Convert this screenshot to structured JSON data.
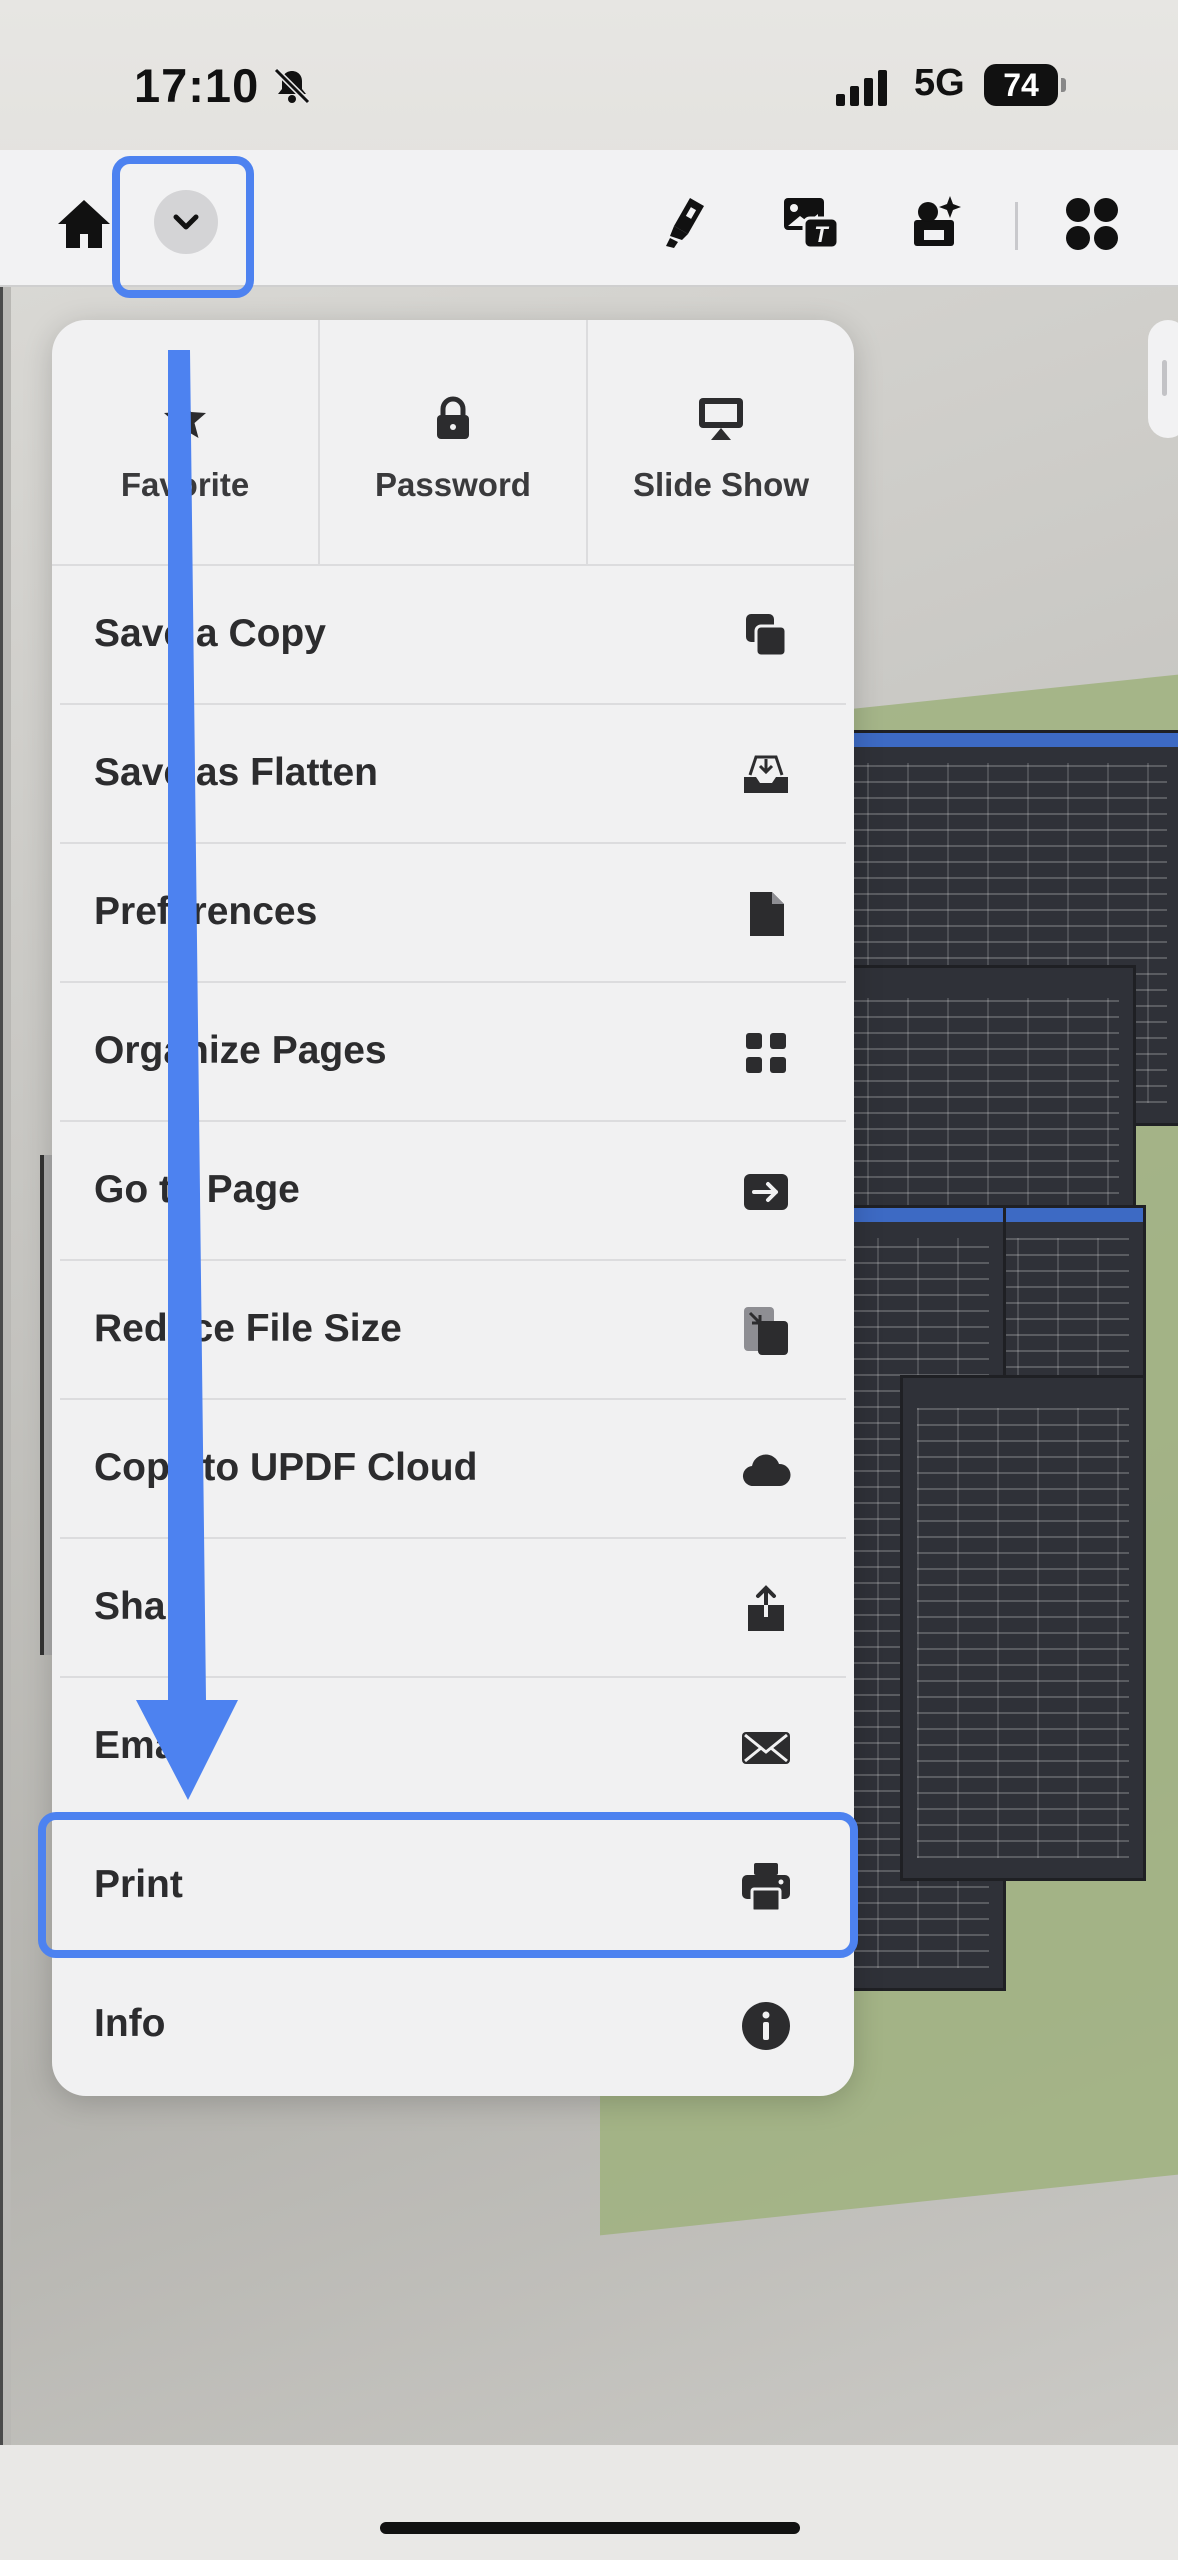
{
  "status_bar": {
    "time": "17:10",
    "network": "5G",
    "battery": "74"
  },
  "toolbar": {
    "icons": [
      "home-icon",
      "chevron-down-icon",
      "highlighter-icon",
      "edit-text-image-icon",
      "ai-sparkle-icon",
      "apps-grid-icon"
    ]
  },
  "menu": {
    "top_actions": [
      {
        "label": "Favorite",
        "icon": "star-icon"
      },
      {
        "label": "Password",
        "icon": "lock-icon"
      },
      {
        "label": "Slide Show",
        "icon": "presentation-icon"
      }
    ],
    "items": [
      {
        "label": "Save a Copy",
        "icon": "copy-icon"
      },
      {
        "label": "Save as Flatten",
        "icon": "tray-download-icon"
      },
      {
        "label": "Preferences",
        "icon": "document-icon"
      },
      {
        "label": "Organize Pages",
        "icon": "grid-icon"
      },
      {
        "label": "Go to Page",
        "icon": "arrow-right-box-icon"
      },
      {
        "label": "Reduce File Size",
        "icon": "compress-file-icon"
      },
      {
        "label": "Copy to UPDF Cloud",
        "icon": "cloud-icon"
      },
      {
        "label": "Share",
        "icon": "share-icon"
      },
      {
        "label": "Email",
        "icon": "envelope-icon"
      },
      {
        "label": "Print",
        "icon": "printer-icon"
      },
      {
        "label": "Info",
        "icon": "info-icon"
      }
    ]
  },
  "colors": {
    "highlight": "#4d82f0",
    "menu_bg": "#f1f1f2",
    "text": "#2c2c2e"
  }
}
